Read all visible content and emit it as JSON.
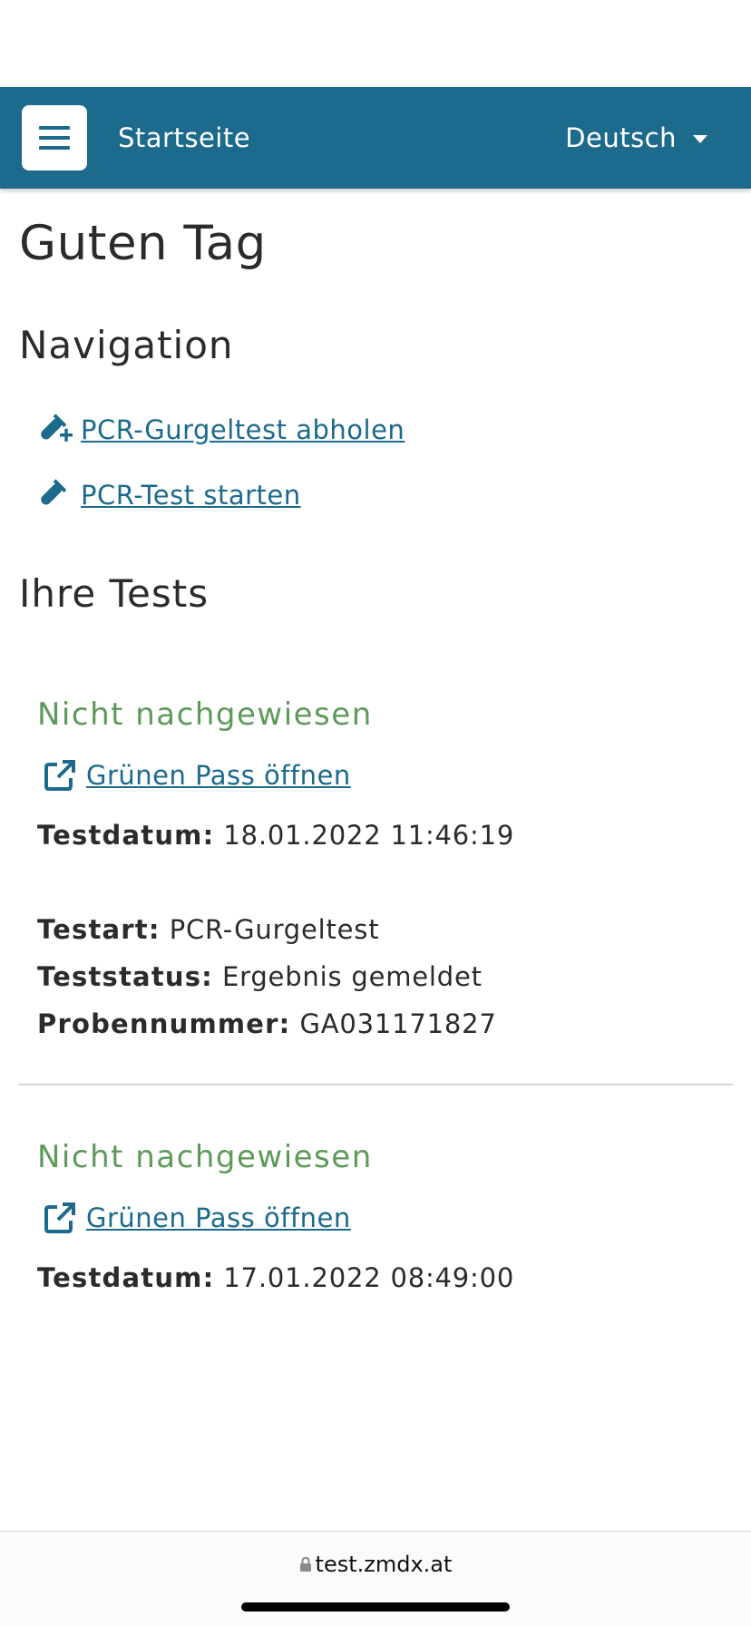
{
  "header": {
    "title": "Startseite",
    "language": "Deutsch",
    "icons": {
      "menu": "hamburger-menu-icon",
      "language_caret": "caret-down-icon"
    }
  },
  "main": {
    "greeting": "Guten Tag",
    "navigation_heading": "Navigation",
    "navigation_links": [
      {
        "label": "PCR-Gurgeltest abholen",
        "icon": "test-tube-plus-icon"
      },
      {
        "label": "PCR-Test starten",
        "icon": "test-tube-icon"
      }
    ],
    "tests_heading": "Ihre Tests",
    "tests": [
      {
        "result": "Nicht nachgewiesen",
        "pass_link": "Grünen Pass öffnen",
        "date_label": "Testdatum:",
        "date": "18.01.2022 11:46:19",
        "type_label": "Testart:",
        "type": "PCR-Gurgeltest",
        "status_label": "Teststatus:",
        "status": "Ergebnis gemeldet",
        "sample_label": "Probennummer:",
        "sample": "GA031171827"
      },
      {
        "result": "Nicht nachgewiesen",
        "pass_link": "Grünen Pass öffnen",
        "date_label": "Testdatum:",
        "date": "17.01.2022 08:49:00"
      }
    ]
  },
  "browser": {
    "url": "test.zmdx.at"
  },
  "colors": {
    "navbar": "#1c6a8c",
    "link": "#1c6a8c",
    "result": "#5d9a5a"
  }
}
